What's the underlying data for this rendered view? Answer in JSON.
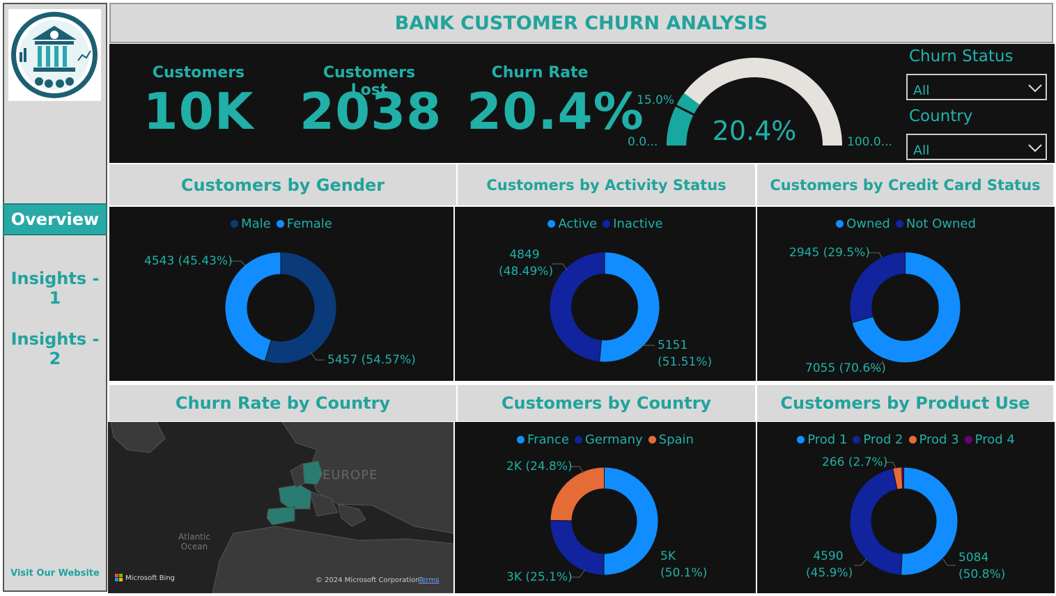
{
  "title": "BANK CUSTOMER CHURN ANALYSIS",
  "sidebar": {
    "active": "Overview",
    "items": [
      "Insights - 1",
      "Insights - 2"
    ],
    "footer_link": "Visit Our Website"
  },
  "kpis": [
    {
      "label": "Customers",
      "value": "10K"
    },
    {
      "label": "Customers Lost",
      "value": "2038"
    },
    {
      "label": "Churn Rate",
      "value": "20.4%"
    }
  ],
  "gauge": {
    "value_label": "20.4%",
    "value": 20.4,
    "target": 15.0,
    "target_label": "15.0%",
    "min_label": "0.0...",
    "max_label": "100.0...",
    "min": 0,
    "max": 100
  },
  "slicers": [
    {
      "label": "Churn Status",
      "value": "All"
    },
    {
      "label": "Country",
      "value": "All"
    }
  ],
  "colors": {
    "accent": "#20b0a8",
    "blue": "#118dff",
    "navy": "#12239e",
    "dark_blue": "#0a3a7a",
    "orange": "#e66c37",
    "purple": "#6b007b",
    "panel": "#121212"
  },
  "map": {
    "title": "Churn Rate by Country",
    "label_europe": "EUROPE",
    "label_ocean_1": "Atlantic",
    "label_ocean_2": "Ocean",
    "attribution": "© 2024 Microsoft Corporation",
    "terms": "Terms",
    "provider": "Microsoft Bing"
  },
  "chart_data": [
    {
      "type": "pie",
      "title": "Customers by Gender",
      "categories": [
        "Male",
        "Female"
      ],
      "values": [
        5457,
        4543
      ],
      "labels": {
        "Female": "4543 (45.43%)",
        "Male": "5457 (54.57%)"
      }
    },
    {
      "type": "pie",
      "title": "Customers by Activity Status",
      "categories": [
        "Active",
        "Inactive"
      ],
      "values": [
        5151,
        4849
      ],
      "labels": {
        "Inactive_1": "4849",
        "Inactive_2": "(48.49%)",
        "Active_1": "5151",
        "Active_2": "(51.51%)"
      }
    },
    {
      "type": "pie",
      "title": "Customers by Credit Card Status",
      "categories": [
        "Owned",
        "Not Owned"
      ],
      "values": [
        7055,
        2945
      ],
      "labels": {
        "Not Owned": "2945 (29.5%)",
        "Owned": "7055 (70.6%)"
      }
    },
    {
      "type": "pie",
      "title": "Customers by Country",
      "categories": [
        "France",
        "Germany",
        "Spain"
      ],
      "values": [
        5014,
        2509,
        2477
      ],
      "labels": {
        "Spain": "2K (24.8%)",
        "Germany": "3K (25.1%)",
        "France_1": "5K",
        "France_2": "(50.1%)"
      }
    },
    {
      "type": "pie",
      "title": "Customers by Product Use",
      "categories": [
        "Prod 1",
        "Prod 2",
        "Prod 3",
        "Prod 4"
      ],
      "values": [
        5084,
        4590,
        266,
        60
      ],
      "labels": {
        "Prod 3": "266 (2.7%)",
        "Prod 2_1": "4590",
        "Prod 2_2": "(45.9%)",
        "Prod 1_1": "5084",
        "Prod 1_2": "(50.8%)"
      }
    }
  ]
}
